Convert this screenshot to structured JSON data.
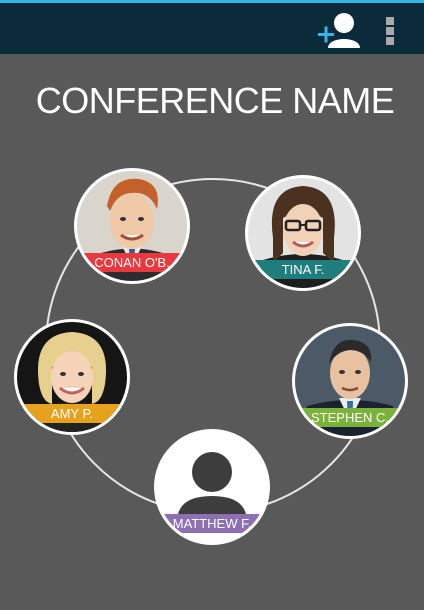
{
  "action_bar": {
    "icons": [
      "add-user-icon",
      "overflow-menu-icon"
    ],
    "background": "#0c2b3a",
    "accent": "#33b5e5"
  },
  "conference": {
    "name": "CONFERENCE NAME"
  },
  "participants": [
    {
      "name": "CONAN O'B.",
      "color": "#e8393e"
    },
    {
      "name": "TINA F.",
      "color": "#1f7d7d"
    },
    {
      "name": "AMY P.",
      "color": "#e6a21c"
    },
    {
      "name": "STEPHEN C.",
      "color": "#7bb33a"
    },
    {
      "name": "MATTHEW F.",
      "color": "#8e6fb2"
    }
  ]
}
